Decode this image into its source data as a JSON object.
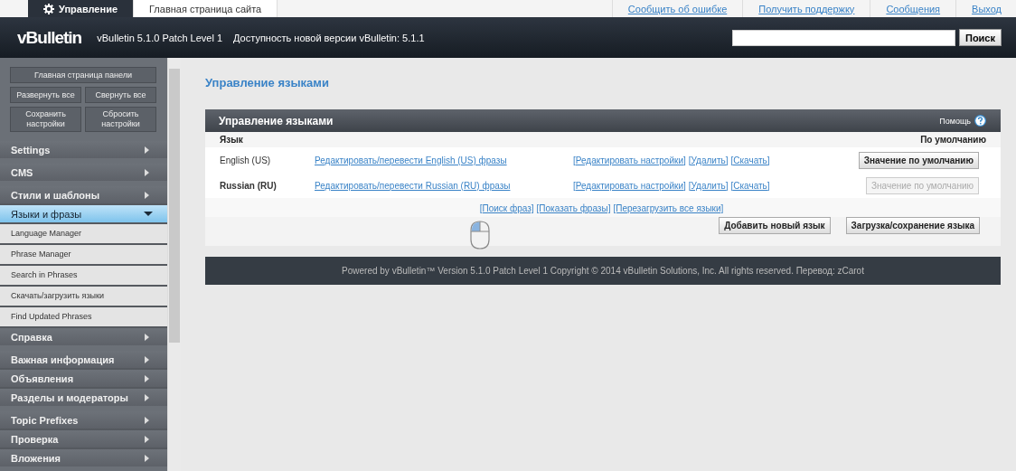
{
  "top_tabs": [
    {
      "label": "Управление",
      "selected": true
    },
    {
      "label": "Главная страница сайта",
      "selected": false
    }
  ],
  "top_links": [
    "Сообщить об ошибке",
    "Получить поддержку",
    "Сообщения",
    "Выход"
  ],
  "header": {
    "logo": "vBulletin",
    "version": "vBulletin 5.1.0 Patch Level 1",
    "notice": "Доступность новой версии vBulletin: 5.1.1",
    "search_button": "Поиск"
  },
  "sidebar": {
    "buttons": [
      [
        "Главная страница панели"
      ],
      [
        "Развернуть все",
        "Свернуть все"
      ],
      [
        "Сохранить настройки",
        "Сбросить настройки"
      ]
    ],
    "groups": [
      [
        {
          "label": "Settings",
          "expanded": false
        }
      ],
      [
        {
          "label": "CMS",
          "expanded": false
        }
      ],
      [
        {
          "label": "Стили и шаблоны",
          "expanded": false
        },
        {
          "label": "Языки и фразы",
          "expanded": true,
          "children": [
            "Language Manager",
            "Phrase Manager",
            "Search in Phrases",
            "Скачать/загрузить языки",
            "Find Updated Phrases"
          ]
        },
        {
          "label": "Справка",
          "expanded": false
        }
      ],
      [
        {
          "label": "Важная информация",
          "expanded": false
        },
        {
          "label": "Объявления",
          "expanded": false
        },
        {
          "label": "Разделы и модераторы",
          "expanded": false
        }
      ],
      [
        {
          "label": "Topic Prefixes",
          "expanded": false
        },
        {
          "label": "Проверка",
          "expanded": false
        },
        {
          "label": "Вложения",
          "expanded": false
        }
      ]
    ]
  },
  "page_title": "Управление языками",
  "panel": {
    "title": "Управление языками",
    "help": "Помощь",
    "columns": [
      "Язык",
      "По умолчанию"
    ],
    "rows": [
      {
        "name": "English (US)",
        "default": false,
        "edit_link": "Редактировать/перевести English (US) фразы",
        "links": [
          "[Редактировать настройки]",
          "[Удалить]",
          "[Скачать]"
        ],
        "button": "Значение по умолчанию"
      },
      {
        "name": "Russian (RU)",
        "default": true,
        "edit_link": "Редактировать/перевести Russian (RU) фразы",
        "links": [
          "[Редактировать настройки]",
          "[Удалить]",
          "[Скачать]"
        ],
        "button": "Значение по умолчанию"
      }
    ],
    "footer_links": [
      "[Поиск фраз]",
      "[Показать фразы]",
      "[Перезагрузить все языки]"
    ],
    "buttons": [
      "Добавить новый язык",
      "Загрузка/сохранение языка"
    ]
  },
  "copyright": "Powered by vBulletin™ Version 5.1.0 Patch Level 1 Copyright © 2014 vBulletin Solutions, Inc. All rights reserved. Перевод: zCarot"
}
